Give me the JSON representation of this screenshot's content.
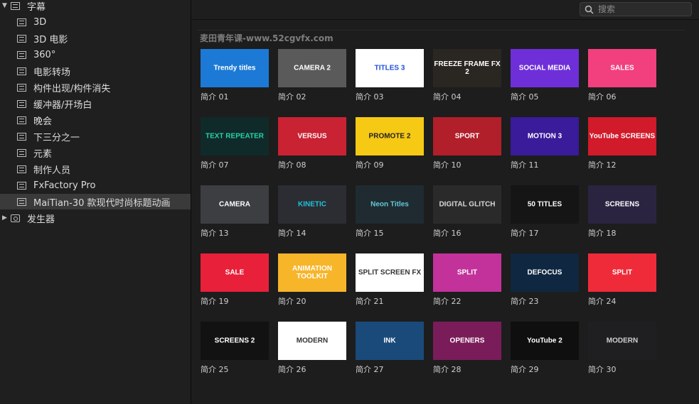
{
  "sidebar": {
    "items": [
      {
        "label": "字幕",
        "type": "folder",
        "expanded": true,
        "level": 0
      },
      {
        "label": "3D",
        "type": "title",
        "level": 1
      },
      {
        "label": "3D 电影",
        "type": "title",
        "level": 1
      },
      {
        "label": "360°",
        "type": "title",
        "level": 1
      },
      {
        "label": "电影转场",
        "type": "title",
        "level": 1
      },
      {
        "label": "构件出现/构件消失",
        "type": "title",
        "level": 1
      },
      {
        "label": "缓冲器/开场白",
        "type": "title",
        "level": 1
      },
      {
        "label": "晚会",
        "type": "title",
        "level": 1
      },
      {
        "label": "下三分之一",
        "type": "title",
        "level": 1
      },
      {
        "label": "元素",
        "type": "title",
        "level": 1
      },
      {
        "label": "制作人员",
        "type": "title",
        "level": 1
      },
      {
        "label": "FxFactory Pro",
        "type": "title",
        "level": 1
      },
      {
        "label": "MaiTian-30 款现代时尚标题动画",
        "type": "title",
        "level": 1,
        "selected": true
      },
      {
        "label": "发生器",
        "type": "generator",
        "expanded": false,
        "level": 0
      }
    ]
  },
  "search": {
    "placeholder": "搜索",
    "value": ""
  },
  "watermark": "麦田青年课-www.52cgvfx.com",
  "thumbnails": [
    {
      "caption": "简介 01",
      "thumb_text": "Trendy titles",
      "bg": "#1c7ad6",
      "fg": "#ffffff"
    },
    {
      "caption": "简介 02",
      "thumb_text": "CAMERA 2",
      "bg": "#5a5a5a",
      "fg": "#ffffff"
    },
    {
      "caption": "简介 03",
      "thumb_text": "TITLES 3",
      "bg": "#ffffff",
      "fg": "#1e4fd8"
    },
    {
      "caption": "简介 04",
      "thumb_text": "FREEZE FRAME FX 2",
      "bg": "#2a2723",
      "fg": "#ffffff"
    },
    {
      "caption": "简介 05",
      "thumb_text": "SOCIAL MEDIA",
      "bg": "#6e2fd9",
      "fg": "#ffffff"
    },
    {
      "caption": "简介 06",
      "thumb_text": "SALES",
      "bg": "#f23f7e",
      "fg": "#ffffff"
    },
    {
      "caption": "简介 07",
      "thumb_text": "TEXT REPEATER",
      "bg": "#102a2a",
      "fg": "#27d3a4"
    },
    {
      "caption": "简介 08",
      "thumb_text": "VERSUS",
      "bg": "#c92233",
      "fg": "#ffffff"
    },
    {
      "caption": "简介 09",
      "thumb_text": "PROMOTE 2",
      "bg": "#f6c915",
      "fg": "#222222"
    },
    {
      "caption": "简介 10",
      "thumb_text": "SPORT",
      "bg": "#b01f2a",
      "fg": "#ffffff"
    },
    {
      "caption": "简介 11",
      "thumb_text": "MOTION 3",
      "bg": "#3a1b9a",
      "fg": "#ffffff"
    },
    {
      "caption": "简介 12",
      "thumb_text": "YouTube SCREENS",
      "bg": "#d11a2a",
      "fg": "#ffffff"
    },
    {
      "caption": "简介 13",
      "thumb_text": "CAMERA",
      "bg": "#3d3e42",
      "fg": "#ffffff"
    },
    {
      "caption": "简介 14",
      "thumb_text": "KINETIC",
      "bg": "#2b2d33",
      "fg": "#21c1d8"
    },
    {
      "caption": "简介 15",
      "thumb_text": "Neon Titles",
      "bg": "#1f2b30",
      "fg": "#63c8d9"
    },
    {
      "caption": "简介 16",
      "thumb_text": "DIGITAL GLITCH",
      "bg": "#2a2a2a",
      "fg": "#d9d9d9"
    },
    {
      "caption": "简介 17",
      "thumb_text": "50 TITLES",
      "bg": "#151515",
      "fg": "#ffffff"
    },
    {
      "caption": "简介 18",
      "thumb_text": "SCREENS",
      "bg": "#2a2440",
      "fg": "#ffffff"
    },
    {
      "caption": "简介 19",
      "thumb_text": "SALE",
      "bg": "#e8203a",
      "fg": "#ffffff"
    },
    {
      "caption": "简介 20",
      "thumb_text": "ANIMATION TOOLKIT",
      "bg": "#f7b52a",
      "fg": "#ffffff"
    },
    {
      "caption": "简介 21",
      "thumb_text": "SPLIT SCREEN FX",
      "bg": "#ffffff",
      "fg": "#333333"
    },
    {
      "caption": "简介 22",
      "thumb_text": "SPLIT",
      "bg": "#c2329a",
      "fg": "#ffffff"
    },
    {
      "caption": "简介 23",
      "thumb_text": "DEFOCUS",
      "bg": "#0f2740",
      "fg": "#ffffff"
    },
    {
      "caption": "简介 24",
      "thumb_text": "SPLIT",
      "bg": "#ef2b3a",
      "fg": "#ffffff"
    },
    {
      "caption": "简介 25",
      "thumb_text": "SCREENS 2",
      "bg": "#121212",
      "fg": "#ffffff"
    },
    {
      "caption": "简介 26",
      "thumb_text": "MODERN",
      "bg": "#ffffff",
      "fg": "#333333"
    },
    {
      "caption": "简介 27",
      "thumb_text": "INK",
      "bg": "#1a4a7a",
      "fg": "#ffffff"
    },
    {
      "caption": "简介 28",
      "thumb_text": "OPENERS",
      "bg": "#7a1c5a",
      "fg": "#ffffff"
    },
    {
      "caption": "简介 29",
      "thumb_text": "YouTube 2",
      "bg": "#0f0f0f",
      "fg": "#ffffff"
    },
    {
      "caption": "简介 30",
      "thumb_text": "MODERN",
      "bg": "#1f1f22",
      "fg": "#cfcfcf"
    }
  ]
}
